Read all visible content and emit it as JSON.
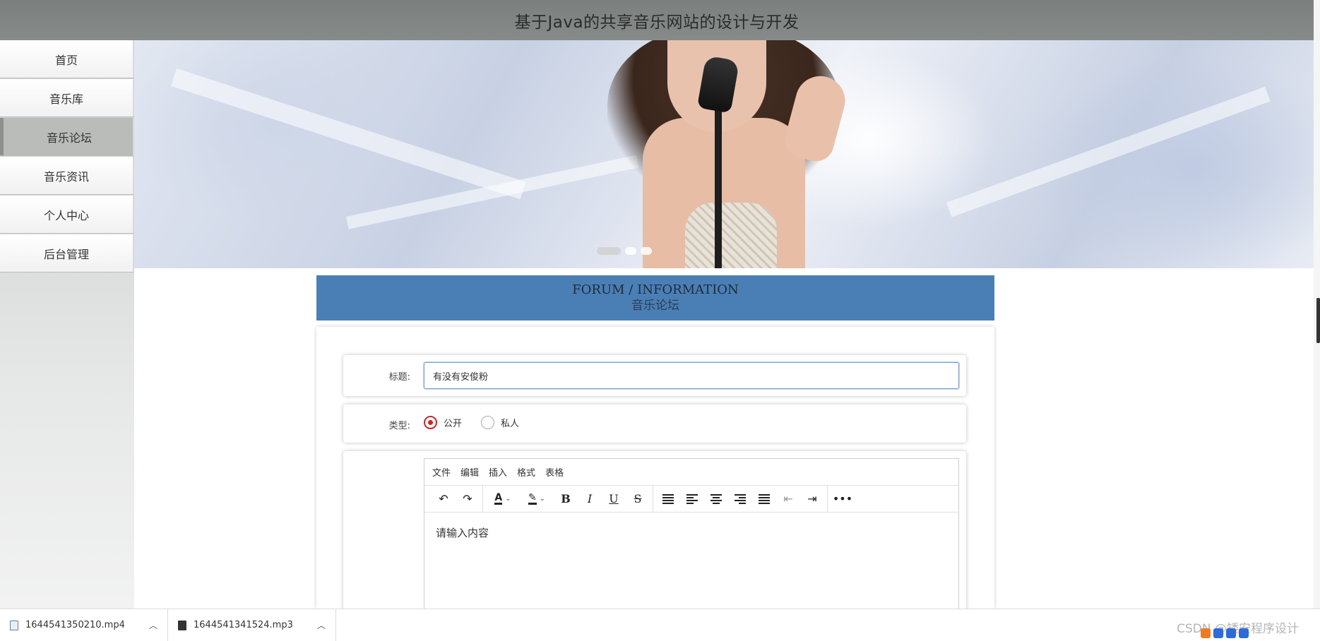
{
  "header": {
    "title": "基于Java的共享音乐网站的设计与开发"
  },
  "sidebar": {
    "items": [
      {
        "label": "首页",
        "active": false
      },
      {
        "label": "音乐库",
        "active": false
      },
      {
        "label": "音乐论坛",
        "active": true
      },
      {
        "label": "音乐资讯",
        "active": false
      },
      {
        "label": "个人中心",
        "active": false
      },
      {
        "label": "后台管理",
        "active": false
      }
    ]
  },
  "banner": {
    "slide_count": 3,
    "active_slide": 1
  },
  "forum": {
    "heading_en": "FORUM / INFORMATION",
    "heading_cn": "音乐论坛"
  },
  "form": {
    "title_label": "标题:",
    "title_value": "有没有安俊粉",
    "type_label": "类型:",
    "type_options": [
      {
        "label": "公开",
        "checked": true
      },
      {
        "label": "私人",
        "checked": false
      }
    ],
    "editor": {
      "menu": [
        "文件",
        "编辑",
        "插入",
        "格式",
        "表格"
      ],
      "placeholder": "请输入内容",
      "toolbar_icons": [
        "undo-icon",
        "redo-icon",
        "font-color-icon",
        "highlight-icon",
        "bold-icon",
        "italic-icon",
        "underline-icon",
        "strikethrough-icon",
        "line-height-icon",
        "align-left-icon",
        "align-center-icon",
        "align-right-icon",
        "align-justify-icon",
        "outdent-icon",
        "indent-icon",
        "more-icon"
      ]
    }
  },
  "downloads": [
    {
      "name": "1644541350210.mp4"
    },
    {
      "name": "1644541341524.mp3"
    }
  ],
  "watermark": "CSDN @矮安程序设计",
  "colors": {
    "forum_header": "#4a7fb5",
    "radio_checked": "#c62929",
    "topbar": "#7f8482"
  }
}
